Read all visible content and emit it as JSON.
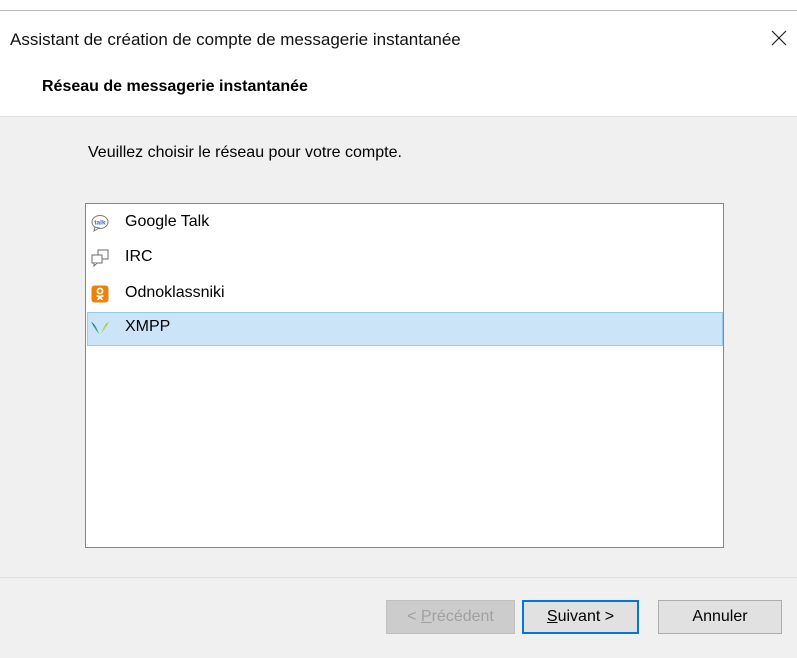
{
  "window": {
    "title": "Assistant de création de compte de messagerie instantanée"
  },
  "header": {
    "title": "Réseau de messagerie instantanée"
  },
  "content": {
    "instruction": "Veuillez choisir le réseau pour votre compte.",
    "networks": [
      {
        "label": "Google Talk",
        "icon": "google-talk-icon",
        "selected": false
      },
      {
        "label": "IRC",
        "icon": "irc-icon",
        "selected": false
      },
      {
        "label": "Odnoklassniki",
        "icon": "odnoklassniki-icon",
        "selected": false
      },
      {
        "label": "XMPP",
        "icon": "xmpp-icon",
        "selected": true
      }
    ]
  },
  "buttons": {
    "previous": {
      "prefix": "< ",
      "accel": "P",
      "rest": "récédent",
      "enabled": false
    },
    "next": {
      "accel": "S",
      "rest": "uivant >",
      "enabled": true
    },
    "cancel": {
      "label": "Annuler"
    }
  },
  "colors": {
    "selection_bg": "#cce4f7",
    "selection_border": "#99c9ef",
    "focus_border": "#0078d7",
    "odnoklassniki": "#ee8208",
    "xmpp_left": "#1b7f6f",
    "xmpp_right": "#8fbf3a"
  }
}
